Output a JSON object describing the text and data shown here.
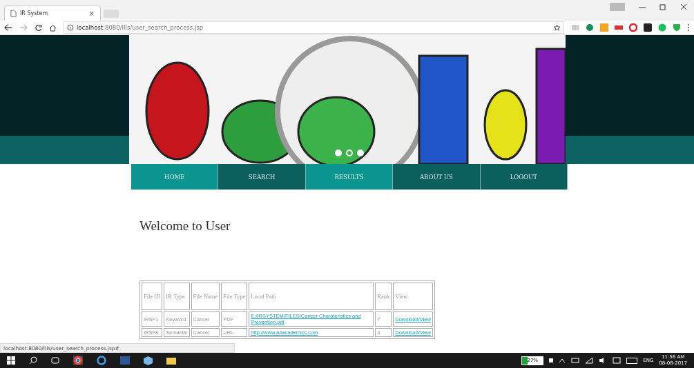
{
  "browser": {
    "tab_title": "IR System",
    "tab_close": "×",
    "url_host": "localhost",
    "url_rest": ":8080/IIIs/user_search_process.jsp",
    "status_url": "localhost:8080/IIIs/user_search_process.jsp#"
  },
  "carousel": {
    "dots": [
      {
        "selected": false
      },
      {
        "selected": true
      },
      {
        "selected": false
      }
    ]
  },
  "nav": [
    {
      "label": "HOME",
      "highlighted": true
    },
    {
      "label": "SEARCH",
      "highlighted": false
    },
    {
      "label": "RESULTS",
      "highlighted": true
    },
    {
      "label": "ABOUT US",
      "highlighted": false
    },
    {
      "label": "LOGOUT",
      "highlighted": false
    }
  ],
  "heading": "Welcome to User",
  "table": {
    "columns": [
      "File ID",
      "IR Type",
      "File Name",
      "File Type",
      "Local Path",
      "Rank",
      "View"
    ],
    "rows": [
      [
        "IRSF1",
        "Keyword",
        "Cancer",
        "PDF",
        {
          "link": "E:/IRSYSTEM/FILES/Cancer Charateristics and Prevention.pdf"
        },
        "7",
        {
          "link": "Download/View"
        }
      ],
      [
        "IRSF8",
        "Semantic",
        "Cancer",
        "URL",
        {
          "link": "http://www.a4academics.com"
        },
        "4",
        {
          "link": "Download/View"
        }
      ]
    ]
  },
  "taskbar": {
    "battery": {
      "label": "27%",
      "level": 0.27
    },
    "language": "ENG",
    "time": "11:56 AM",
    "date": "08-08-2017"
  }
}
